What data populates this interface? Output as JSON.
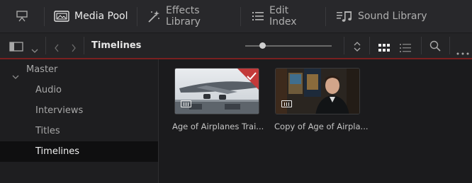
{
  "tabs": [
    {
      "label": "",
      "icon": "monitor-icon"
    },
    {
      "label": "Media Pool",
      "icon": "media-pool-icon",
      "active": true
    },
    {
      "label": "Effects Library",
      "icon": "effects-wand-icon"
    },
    {
      "label": "Edit Index",
      "icon": "list-icon"
    },
    {
      "label": "Sound Library",
      "icon": "sound-library-icon"
    }
  ],
  "toolbar": {
    "breadcrumb": "Timelines",
    "zoom_level": 0.2
  },
  "sidebar": {
    "root": "Master",
    "items": [
      "Audio",
      "Interviews",
      "Titles",
      "Timelines"
    ],
    "selected": "Timelines"
  },
  "clips": [
    {
      "name": "Age of Airplanes Trai...",
      "checked": true
    },
    {
      "name": "Copy of Age of Airpla..."
    }
  ],
  "colors": {
    "accent_red": "#c33a3a",
    "selection_bg": "#0f0f10"
  }
}
